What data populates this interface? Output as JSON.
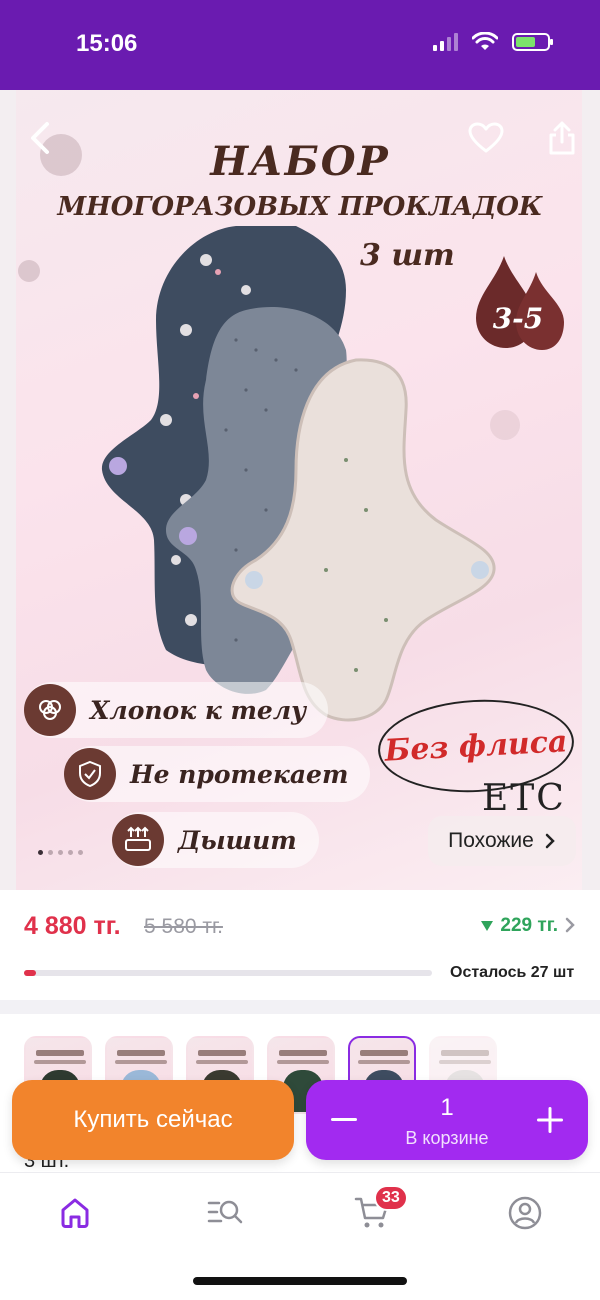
{
  "status_bar": {
    "time": "15:06"
  },
  "hero": {
    "title_line1": "НАБОР",
    "title_line2": "МНОГОРАЗОВЫХ ПРОКЛАДОК",
    "title_line3": "3 шт",
    "drops_label": "3-5",
    "features": [
      "Хлопок к телу",
      "Не протекает",
      "Дышит"
    ],
    "no_fleece_label": "Без флиса",
    "brand_mark": "ETC",
    "similar_label": "Похожие",
    "slide_count": 5,
    "active_slide": 1
  },
  "price": {
    "current": "4 880 тг.",
    "old": "5 580 тг.",
    "drop": "229 тг.",
    "stock_text": "Осталось 27 шт",
    "stock_fraction": 0.03
  },
  "variants": {
    "count": 7,
    "selected_index": 4
  },
  "description_fragment": "3 шт.",
  "actions": {
    "buy_now_label": "Купить сейчас",
    "cart_quantity": "1",
    "in_cart_label": "В корзине"
  },
  "tabbar": {
    "cart_badge": "33"
  },
  "colors": {
    "status_bar": "#6A1BB0",
    "price_red": "#E0314B",
    "price_drop_green": "#2fa45b",
    "buy_now_orange": "#F2842C",
    "cart_purple": "#A22AF0",
    "active_tab": "#8a2be2"
  },
  "icons": [
    "back-icon",
    "heart-icon",
    "share-icon",
    "cotton-icon",
    "shield-icon",
    "breathable-icon",
    "home-icon",
    "catalog-search-icon",
    "cart-icon",
    "profile-icon"
  ]
}
